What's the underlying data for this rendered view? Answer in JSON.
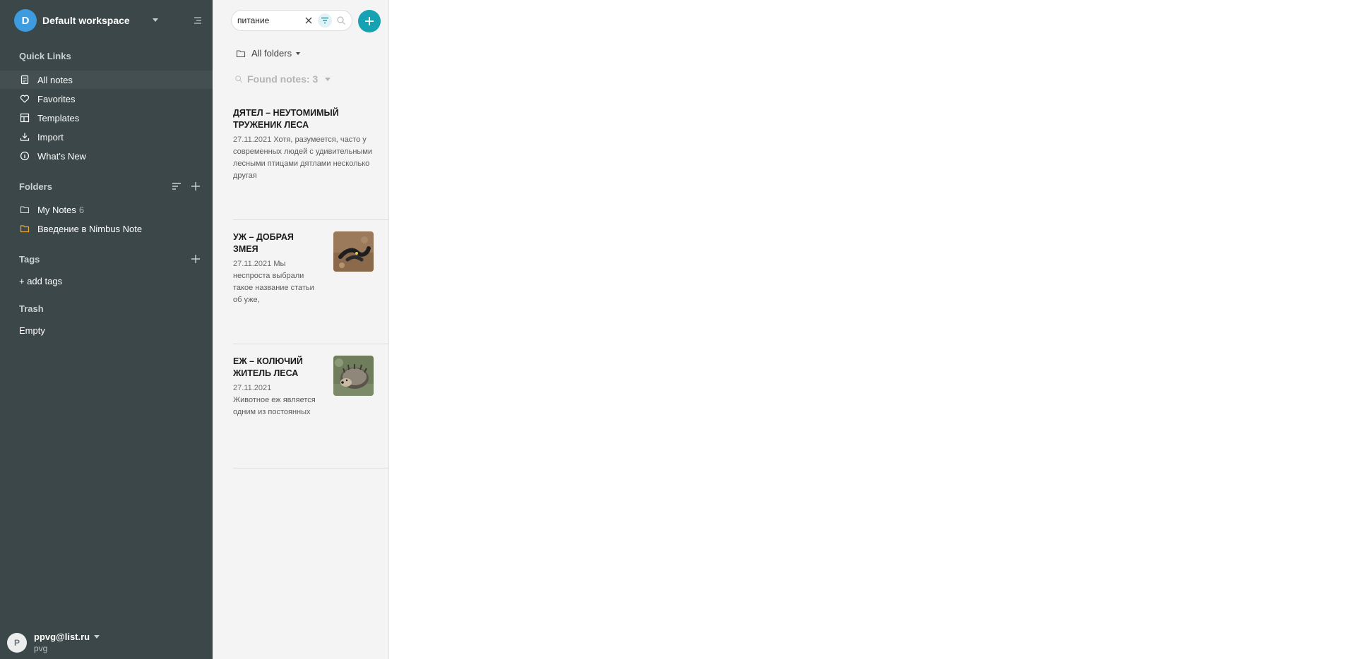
{
  "workspace": {
    "avatar_letter": "D",
    "name": "Default workspace"
  },
  "quick_links": {
    "title": "Quick Links",
    "items": [
      {
        "label": "All notes",
        "icon": "note-icon"
      },
      {
        "label": "Favorites",
        "icon": "heart-icon"
      },
      {
        "label": "Templates",
        "icon": "templates-icon"
      },
      {
        "label": "Import",
        "icon": "import-icon"
      },
      {
        "label": "What's New",
        "icon": "info-icon"
      }
    ]
  },
  "folders": {
    "title": "Folders",
    "items": [
      {
        "label": "My Notes",
        "count": "6",
        "icon": "folder-icon"
      },
      {
        "label": "Введение в Nimbus Note",
        "count": "",
        "icon": "folder-icon"
      }
    ]
  },
  "tags": {
    "title": "Tags",
    "add_label": "+ add tags"
  },
  "trash": {
    "title": "Trash",
    "empty_label": "Empty"
  },
  "user": {
    "avatar_letter": "P",
    "email": "ppvg@list.ru",
    "name": "pvg"
  },
  "search": {
    "value": "питание"
  },
  "folder_filter": {
    "label": "All folders"
  },
  "found": {
    "label": "Found notes: 3"
  },
  "notes": [
    {
      "title": "ДЯТЕЛ – НЕУТОМИМЫЙ ТРУЖЕНИК ЛЕСА",
      "date": "27.11.2021",
      "snippet": "Хотя, разумеется, часто у современных людей с удивительными лесными птицами дятлами несколько другая",
      "has_thumb": false
    },
    {
      "title": "УЖ – ДОБРАЯ ЗМЕЯ",
      "date": "27.11.2021",
      "snippet": "Мы неспроста выбрали такое название статьи об уже,",
      "has_thumb": true,
      "thumb": "snake-photo"
    },
    {
      "title": "ЕЖ – КОЛЮЧИЙ ЖИТЕЛЬ ЛЕСА",
      "date": "27.11.2021",
      "snippet": "Животное еж является одним из постоянных",
      "has_thumb": true,
      "thumb": "hedgehog-photo"
    }
  ],
  "colors": {
    "sidebar": "#3b4748",
    "accent": "#17a2b3",
    "folder_highlight": "#f0a732"
  }
}
